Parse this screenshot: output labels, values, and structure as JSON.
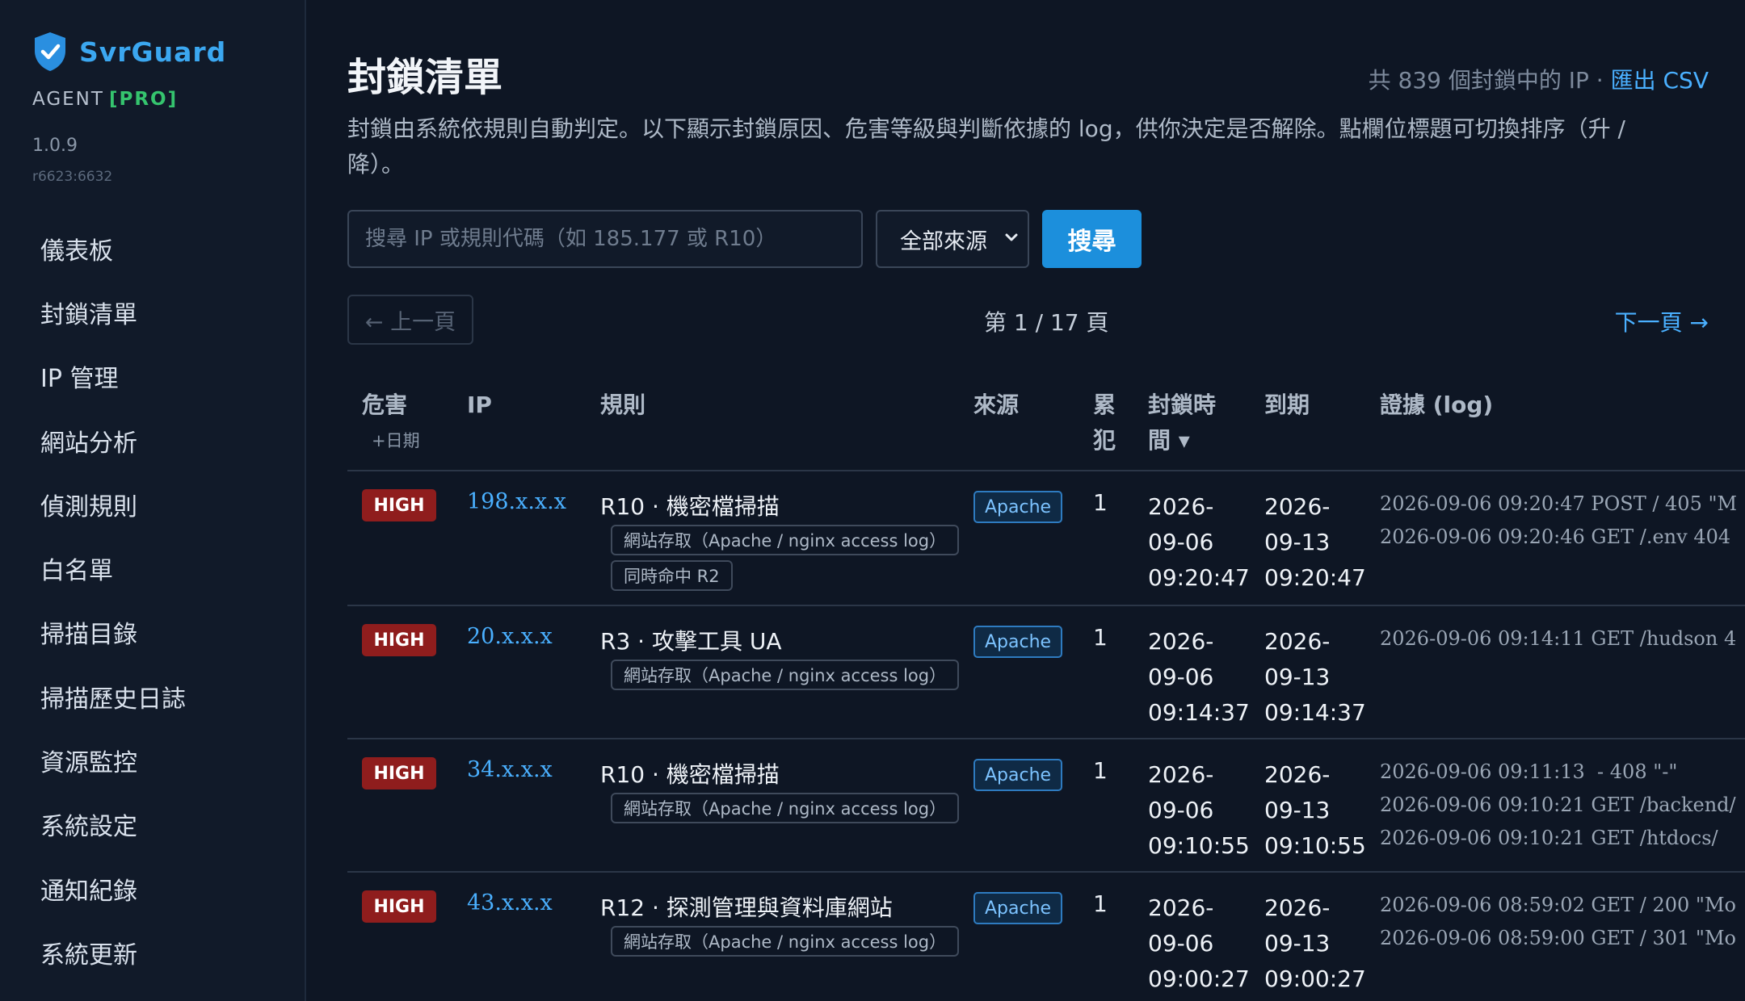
{
  "brand": {
    "name": "SvrGuard",
    "agent": "AGENT",
    "tier": "[PRO]",
    "version": "1.0.9",
    "build": "r6623:6632"
  },
  "nav": [
    {
      "label": "儀表板"
    },
    {
      "label": "封鎖清單"
    },
    {
      "label": "IP 管理"
    },
    {
      "label": "網站分析"
    },
    {
      "label": "偵測規則"
    },
    {
      "label": "白名單"
    },
    {
      "label": "掃描目錄"
    },
    {
      "label": "掃描歷史日誌"
    },
    {
      "label": "資源監控"
    },
    {
      "label": "系統設定"
    },
    {
      "label": "通知紀錄"
    },
    {
      "label": "系統更新"
    }
  ],
  "page": {
    "title": "封鎖清單",
    "summary": "共 839 個封鎖中的 IP ·",
    "export_label": "匯出 CSV",
    "description": "封鎖由系統依規則自動判定。以下顯示封鎖原因、危害等級與判斷依據的 log，供你決定是否解除。點欄位標題可切換排序（升 / 降）。"
  },
  "search": {
    "placeholder": "搜尋 IP 或規則代碼（如 185.177 或 R10）",
    "value": "",
    "source_selected": "全部來源",
    "button_label": "搜尋"
  },
  "pagination": {
    "prev_label": "← 上一頁",
    "info": "第 1 / 17 頁",
    "next_label": "下一頁 →"
  },
  "table": {
    "headers": {
      "severity": "危害",
      "severity_sub": "+日期",
      "ip": "IP",
      "rule": "規則",
      "source": "來源",
      "repeat": "累\n犯",
      "blocked_at": "封鎖時\n間 ▾",
      "expires": "到期",
      "evidence": "證據 (log)"
    },
    "rows": [
      {
        "severity": "HIGH",
        "ip": "198.x.x.x",
        "rule": "R10 · 機密檔掃描",
        "tags": [
          "網站存取（Apache / nginx access log）",
          "同時命中 R2"
        ],
        "source": "Apache",
        "repeat": "1",
        "blocked_at": "2026-\n09-06\n09:20:47",
        "expires": "2026-\n09-13\n09:20:47",
        "evidence": "2026-09-06 09:20:47 POST / 405 \"M\n2026-09-06 09:20:46 GET /.env 404"
      },
      {
        "severity": "HIGH",
        "ip": "20.x.x.x",
        "rule": "R3 · 攻擊工具 UA",
        "tags": [
          "網站存取（Apache / nginx access log）"
        ],
        "source": "Apache",
        "repeat": "1",
        "blocked_at": "2026-\n09-06\n09:14:37",
        "expires": "2026-\n09-13\n09:14:37",
        "evidence": "2026-09-06 09:14:11 GET /hudson 4"
      },
      {
        "severity": "HIGH",
        "ip": "34.x.x.x",
        "rule": "R10 · 機密檔掃描",
        "tags": [
          "網站存取（Apache / nginx access log）"
        ],
        "source": "Apache",
        "repeat": "1",
        "blocked_at": "2026-\n09-06\n09:10:55",
        "expires": "2026-\n09-13\n09:10:55",
        "evidence": "2026-09-06 09:11:13  - 408 \"-\"\n2026-09-06 09:10:21 GET /backend/\n2026-09-06 09:10:21 GET /htdocs/"
      },
      {
        "severity": "HIGH",
        "ip": "43.x.x.x",
        "rule": "R12 · 探測管理與資料庫網站",
        "tags": [
          "網站存取（Apache / nginx access log）"
        ],
        "source": "Apache",
        "repeat": "1",
        "blocked_at": "2026-\n09-06\n09:00:27",
        "expires": "2026-\n09-13\n09:00:27",
        "evidence": "2026-09-06 08:59:02 GET / 200 \"Mo\n2026-09-06 08:59:00 GET / 301 \"Mo"
      }
    ]
  },
  "colors": {
    "accent": "#1c8fdc",
    "link": "#4ab0ff",
    "high": "#8f1d1d",
    "pro": "#35c46e",
    "bg": "#0e1624",
    "sidebar": "#111a29"
  }
}
